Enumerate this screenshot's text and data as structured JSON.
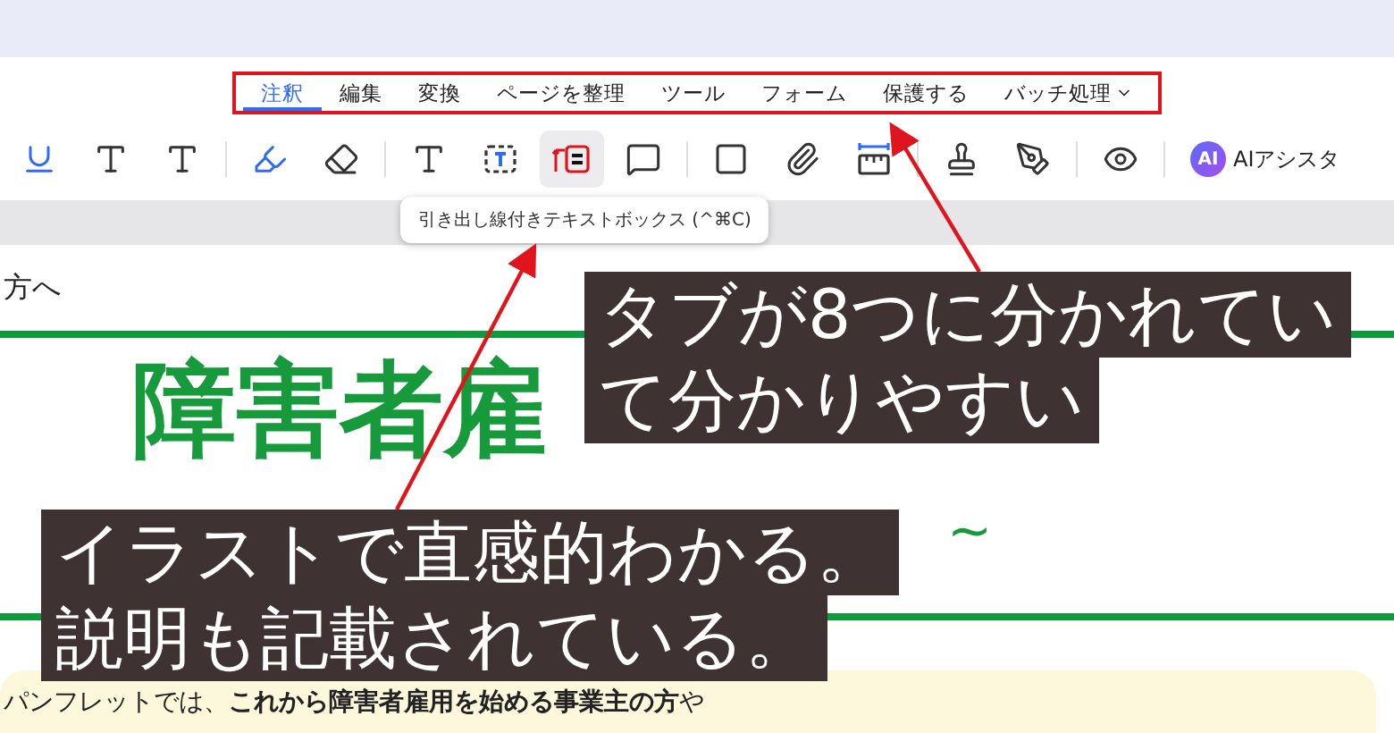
{
  "tabs": [
    {
      "label": "注釈",
      "selected": true
    },
    {
      "label": "編集",
      "selected": false
    },
    {
      "label": "変換",
      "selected": false
    },
    {
      "label": "ページを整理",
      "selected": false
    },
    {
      "label": "ツール",
      "selected": false
    },
    {
      "label": "フォーム",
      "selected": false
    },
    {
      "label": "保護する",
      "selected": false
    },
    {
      "label": "バッチ処理",
      "selected": false,
      "dropdown": true
    }
  ],
  "tools": [
    {
      "kind": "underline",
      "selected": false
    },
    {
      "kind": "squiggly",
      "selected": false
    },
    {
      "kind": "caret",
      "selected": false
    },
    {
      "kind": "divider"
    },
    {
      "kind": "highlighter",
      "selected": false
    },
    {
      "kind": "eraser",
      "selected": false
    },
    {
      "kind": "divider"
    },
    {
      "kind": "text",
      "selected": false
    },
    {
      "kind": "textbox",
      "selected": false
    },
    {
      "kind": "callout",
      "selected": true
    },
    {
      "kind": "note",
      "selected": false
    },
    {
      "kind": "divider"
    },
    {
      "kind": "rectangle",
      "selected": false
    },
    {
      "kind": "attach",
      "selected": false
    },
    {
      "kind": "measure",
      "selected": false
    },
    {
      "kind": "divider"
    },
    {
      "kind": "stamp",
      "selected": false
    },
    {
      "kind": "sign",
      "selected": false
    },
    {
      "kind": "divider"
    },
    {
      "kind": "eye",
      "selected": false
    },
    {
      "kind": "divider"
    }
  ],
  "ai_button": {
    "badge": "AI",
    "label": "AIアシスタ"
  },
  "tooltip": "引き出し線付きテキストボックス (^⌘C)",
  "document": {
    "recipient": "方へ",
    "title": "障害者雇",
    "subtitle": "~",
    "body": "パンフレットでは、**これから障害者雇用を始める事業主の方**や"
  },
  "captions": [
    {
      "lines": [
        "タブが8つに分かれてい",
        "て分かりやすい"
      ]
    },
    {
      "lines": [
        "イラストで直感的わかる。",
        "説明も記載されている。"
      ]
    }
  ]
}
